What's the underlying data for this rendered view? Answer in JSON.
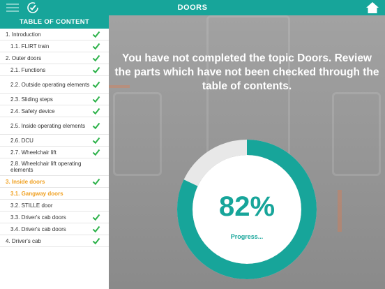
{
  "header": {
    "title": "DOORS"
  },
  "toc": {
    "title": "TABLE OF CONTENT",
    "items": [
      {
        "label": "1. Introduction",
        "checked": true
      },
      {
        "label": "1.1. FLIRT train",
        "checked": true
      },
      {
        "label": "2. Outer doors",
        "checked": true
      },
      {
        "label": "2.1. Functions",
        "checked": true
      },
      {
        "label": "2.2. Outside operating elements",
        "checked": true
      },
      {
        "label": "2.3. Sliding steps",
        "checked": true
      },
      {
        "label": "2.4. Safety device",
        "checked": true
      },
      {
        "label": "2.5. Inside operating elements",
        "checked": true
      },
      {
        "label": "2.6. DCU",
        "checked": true
      },
      {
        "label": "2.7. Wheelchair lift",
        "checked": true
      },
      {
        "label": "2.8. Wheelchair lift operating elements",
        "checked": false
      },
      {
        "label": "3. Inside doors",
        "checked": true
      },
      {
        "label": "3.1. Gangway doors",
        "checked": false
      },
      {
        "label": "3.2. STILLE door",
        "checked": false
      },
      {
        "label": "3.3. Driver's cab doors",
        "checked": true
      },
      {
        "label": "3.4. Driver's cab doors",
        "checked": true
      },
      {
        "label": "4. Driver's cab",
        "checked": true
      }
    ]
  },
  "main": {
    "message": "You have not completed the topic Doors. Review the parts which have not been checked through the table of contents.",
    "progress_text": "82%",
    "progress_value": 0.82,
    "progress_label": "Progress..."
  },
  "colors": {
    "accent": "#17a59a",
    "active": "#f0a020",
    "check": "#2db24a"
  }
}
